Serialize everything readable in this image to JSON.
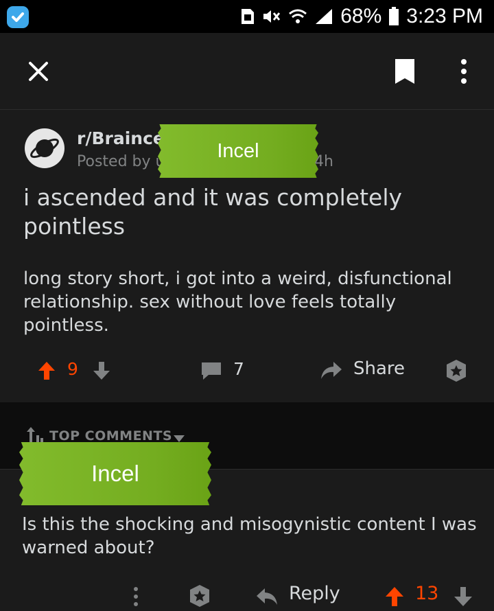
{
  "status_bar": {
    "battery": "68%",
    "time": "3:23 PM"
  },
  "toolbar": {
    "icons": [
      "close-icon",
      "bookmark-icon",
      "more-vertical-icon"
    ]
  },
  "post": {
    "subreddit": "r/Braince",
    "posted_by": "Posted by u",
    "age": "4h",
    "title": "i ascended and it was completely pointless",
    "body": "long story short, i got into a weird, disfunctional relationship. sex without love feels totally pointless.",
    "votes": "9",
    "comments": "7",
    "share_label": "Share"
  },
  "comments_header": {
    "sort_label": "TOP COMMENTS"
  },
  "comment": {
    "text": "Is this the shocking and misogynistic content I was warned about?",
    "reply_label": "Reply",
    "votes": "13"
  },
  "stickers": {
    "first": "Incel",
    "second": "Incel"
  },
  "colors": {
    "background": "#1b1b1b",
    "upvote_orange": "#ff4500",
    "sticker_green": "#7ab526",
    "app_icon_blue": "#3ea8ea"
  }
}
